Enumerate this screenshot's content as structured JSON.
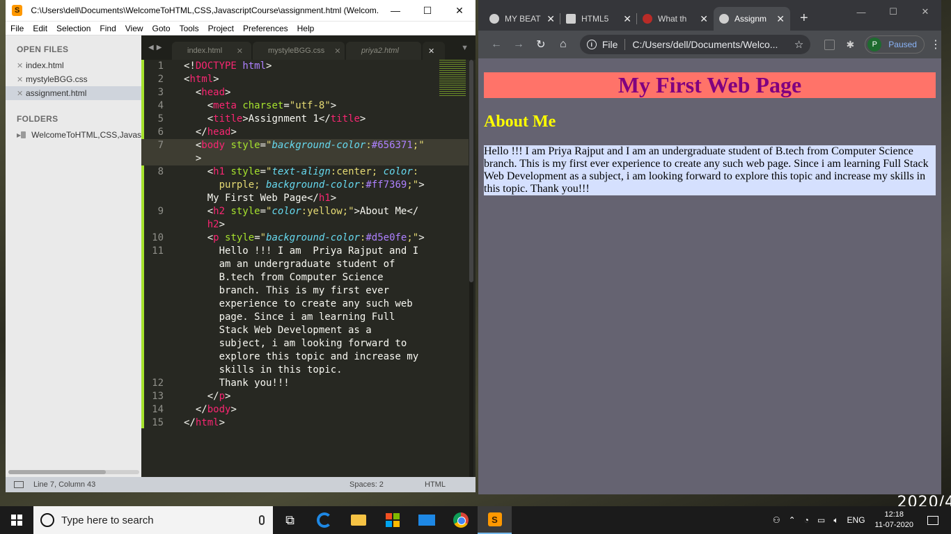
{
  "desktop": {
    "date_fragment": "2020/4"
  },
  "sublime": {
    "title": "C:\\Users\\dell\\Documents\\WelcomeToHTML,CSS,JavascriptCourse\\assignment.html (Welcom...",
    "app_icon": "S",
    "menu": [
      "File",
      "Edit",
      "Selection",
      "Find",
      "View",
      "Goto",
      "Tools",
      "Project",
      "Preferences",
      "Help"
    ],
    "sidebar": {
      "open_files_heading": "OPEN FILES",
      "open_files": [
        "index.html",
        "mystyleBGG.css",
        "assignment.html"
      ],
      "folders_heading": "FOLDERS",
      "folder": "WelcomeToHTML,CSS,Javas"
    },
    "tabs": [
      "index.html",
      "mystyleBGG.css",
      "priya2.html"
    ],
    "line_numbers": [
      "1",
      "2",
      "3",
      "4",
      "5",
      "6",
      "7",
      "",
      "8",
      "",
      "",
      "9",
      "",
      "10",
      "11",
      "",
      "",
      "",
      "",
      "",
      "",
      "",
      "",
      "",
      "12",
      "13",
      "14",
      "15"
    ],
    "status": {
      "position": "Line 7, Column 43",
      "spaces": "Spaces: 2",
      "syntax": "HTML"
    },
    "colors": {
      "background": "#272822",
      "tag": "#f92672",
      "attribute": "#a6e22e",
      "string": "#e6db74",
      "property": "#66d9ef",
      "number": "#ae81ff"
    }
  },
  "chrome": {
    "tabs": [
      "MY BEAT",
      "HTML5",
      "What th",
      "Assignm"
    ],
    "new_tab": "+",
    "scheme": "File",
    "url": "C:/Users/dell/Documents/Welco...",
    "profile_initial": "P",
    "profile_label": "Paused"
  },
  "page": {
    "h1": "My First Web Page",
    "h2": "About Me",
    "paragraph": "Hello !!! I am Priya Rajput and I am an undergraduate student of B.tech from Computer Science branch. This is my first ever experience to create any such web page. Since i am learning Full Stack Web Development as a subject, i am looking forward to explore this topic and increase my skills in this topic. Thank you!!!",
    "colors": {
      "body_bg": "#656371",
      "h1_bg": "#ff7369",
      "h1_color": "purple",
      "h2_color": "yellow",
      "p_bg": "#d5e0fe"
    }
  },
  "taskbar": {
    "search_placeholder": "Type here to search",
    "tray_lang": "ENG",
    "time": "12:18",
    "date": "11-07-2020"
  }
}
